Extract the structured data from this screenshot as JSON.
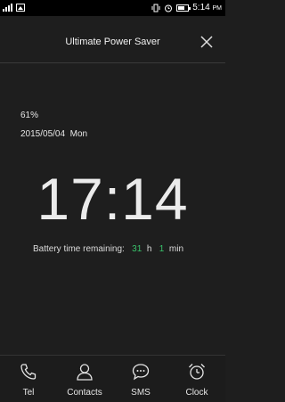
{
  "status_bar": {
    "time": "5:14",
    "ampm": "PM",
    "icons": [
      "signal-icon",
      "gallery-icon",
      "vibrate-icon",
      "alarm-icon",
      "battery-icon"
    ]
  },
  "header": {
    "title": "Ultimate Power Saver",
    "close_icon": "close-icon"
  },
  "info": {
    "battery_percent": "61%",
    "date": "2015/05/04",
    "weekday": "Mon",
    "clock": "17:14",
    "remaining_label": "Battery time remaining:",
    "hours": "31",
    "hours_unit": "h",
    "minutes": "1",
    "minutes_unit": "min"
  },
  "colors": {
    "accent_green": "#39c26b",
    "background": "#1e1e1e"
  },
  "bottom_nav": {
    "items": [
      {
        "label": "Tel",
        "icon": "phone-icon"
      },
      {
        "label": "Contacts",
        "icon": "contacts-icon"
      },
      {
        "label": "SMS",
        "icon": "sms-icon"
      },
      {
        "label": "Clock",
        "icon": "alarm-clock-icon"
      }
    ]
  }
}
